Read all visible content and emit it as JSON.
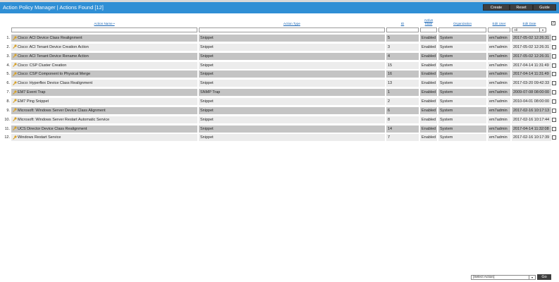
{
  "header": {
    "title": "Action Policy Manager | Actions Found [12]",
    "buttons": [
      "Create",
      "Reset",
      "Guide"
    ]
  },
  "columns": {
    "action_name": "Action Name •",
    "action_type": "Action Type",
    "id": "ID",
    "action_state": "Active State",
    "organization": "Organization",
    "edit_user": "Edit User",
    "edit_date": "Edit Date"
  },
  "filters": {
    "edit_date_select": "All"
  },
  "rows": [
    {
      "n": "1.",
      "name": "Cisco: ACI Device Class Realignment",
      "type": "Snippet",
      "id": "5",
      "state": "Enabled",
      "org": "System",
      "user": "em7admin",
      "date": "2017-05-02 12:26:31"
    },
    {
      "n": "2.",
      "name": "Cisco: ACI Tenant Device Creation Action",
      "type": "Snippet",
      "id": "3",
      "state": "Enabled",
      "org": "System",
      "user": "em7admin",
      "date": "2017-05-02 12:26:31"
    },
    {
      "n": "3.",
      "name": "Cisco: ACI Tenant Device Rename Action",
      "type": "Snippet",
      "id": "4",
      "state": "Enabled",
      "org": "System",
      "user": "em7admin",
      "date": "2017-05-02 12:26:31"
    },
    {
      "n": "4.",
      "name": "Cisco: CSP Cluster Creation",
      "type": "Snippet",
      "id": "15",
      "state": "Enabled",
      "org": "System",
      "user": "em7admin",
      "date": "2017-04-14 11:31:49"
    },
    {
      "n": "5.",
      "name": "Cisco: CSP Component to Physical Merge",
      "type": "Snippet",
      "id": "16",
      "state": "Enabled",
      "org": "System",
      "user": "em7admin",
      "date": "2017-04-14 11:31:49"
    },
    {
      "n": "6.",
      "name": "Cisco: Hyperflex Device Class Realignment",
      "type": "Snippet",
      "id": "13",
      "state": "Enabled",
      "org": "System",
      "user": "em7admin",
      "date": "2017-03-20 09:42:33"
    },
    {
      "n": "7.",
      "name": "EM7 Event Trap",
      "type": "SNMP Trap",
      "id": "1",
      "state": "Enabled",
      "org": "System",
      "user": "em7admin",
      "date": "2009-07-08 08:00:00"
    },
    {
      "n": "8.",
      "name": "EM7 Ping Snippet",
      "type": "Snippet",
      "id": "2",
      "state": "Enabled",
      "org": "System",
      "user": "em7admin",
      "date": "2010-04-01 08:00:00"
    },
    {
      "n": "9.",
      "name": "Microsoft: Windows Server Device Class Alignment",
      "type": "Snippet",
      "id": "6",
      "state": "Enabled",
      "org": "System",
      "user": "em7admin",
      "date": "2017-02-16 10:17:13"
    },
    {
      "n": "10.",
      "name": "Microsoft: Windows Server Restart Automatic Service",
      "type": "Snippet",
      "id": "8",
      "state": "Enabled",
      "org": "System",
      "user": "em7admin",
      "date": "2017-02-16 10:17:44"
    },
    {
      "n": "11.",
      "name": "UCS Director Device Class Realignment",
      "type": "Snippet",
      "id": "14",
      "state": "Enabled",
      "org": "System",
      "user": "em7admin",
      "date": "2017-04-14 11:32:08"
    },
    {
      "n": "12.",
      "name": "Windows Restart Service",
      "type": "Snippet",
      "id": "7",
      "state": "Enabled",
      "org": "System",
      "user": "em7admin",
      "date": "2017-02-16 10:17:39"
    }
  ],
  "footer": {
    "action_select": "[Select Action]",
    "go_label": "Go"
  },
  "colors": {
    "titlebar": "#2f8fd5",
    "row_dark": "#c4c4c4",
    "row_light": "#ececec",
    "key_icon": "#d6a12a"
  }
}
